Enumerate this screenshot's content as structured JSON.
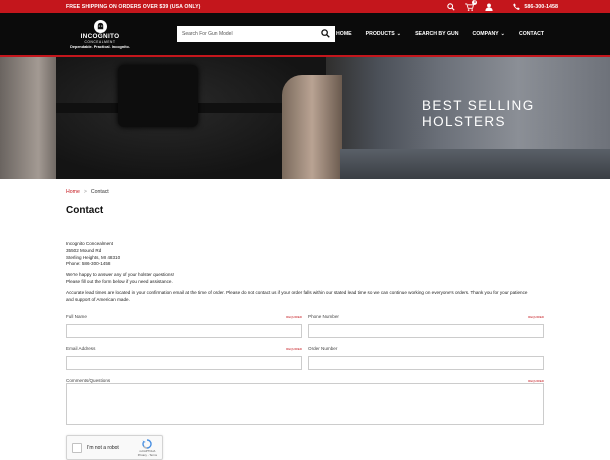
{
  "topbar": {
    "shipping_text": "FREE SHIPPING ON ORDERS OVER $39 (USA ONLY)",
    "cart_count": "0",
    "phone": "586-300-1458"
  },
  "header": {
    "logo": {
      "brand": "INCOGNITO",
      "sub": "CONCEALMENT",
      "tagline": "Dependable. Practical. Incognito."
    },
    "search_placeholder": "Search For Gun Model",
    "nav": [
      {
        "label": "HOME"
      },
      {
        "label": "PRODUCTS",
        "dropdown": true
      },
      {
        "label": "SEARCH BY GUN"
      },
      {
        "label": "COMPANY",
        "dropdown": true
      },
      {
        "label": "CONTACT"
      }
    ]
  },
  "hero": {
    "title_line1": "BEST SELLING",
    "title_line2": "HOLSTERS"
  },
  "breadcrumb": {
    "home": "Home",
    "separator": ">",
    "current": "Contact"
  },
  "page_title": "Contact",
  "info": {
    "company": "Incognito Concealment",
    "address1": "35502 Mound Rd",
    "address2": "Sterling Heights, MI 48310",
    "phone": "Phone: 586-300-1458",
    "help1": "We're happy to answer any of your holster questions!",
    "help2": "Please fill out the form below if you need assistance.",
    "notice": "Accurate lead times are located in your confirmation email at the time of order. Please do not contact us if your order falls within our stated lead time so we can continue working on everyone's orders. Thank you for your patience and support of American made."
  },
  "form": {
    "required_label": "REQUIRED",
    "full_name": "Full Name",
    "phone_number": "Phone Number",
    "email": "Email Address",
    "order_number": "Order Number",
    "comments": "Comments/Questions"
  },
  "captcha": {
    "label": "I'm not a robot",
    "brand": "reCAPTCHA",
    "links": "Privacy - Terms"
  },
  "colors": {
    "accent": "#c4161c",
    "header_bg": "#0b0b0b"
  }
}
